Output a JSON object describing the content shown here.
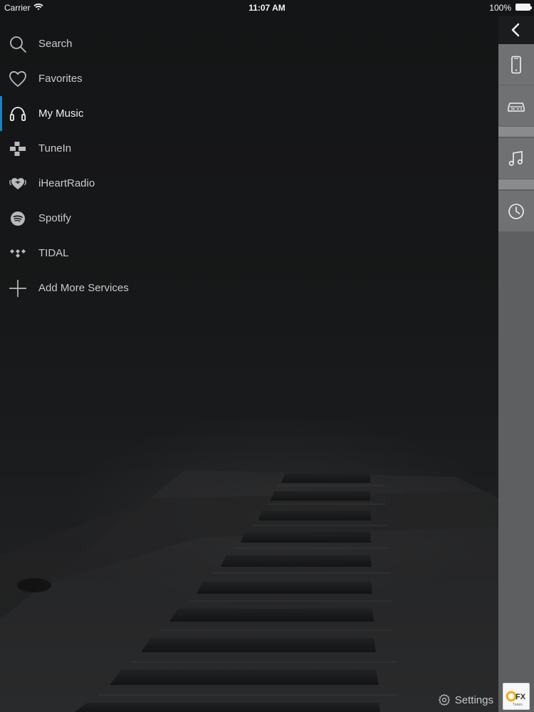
{
  "status_bar": {
    "carrier": "Carrier",
    "time": "11:07 AM",
    "battery": "100%"
  },
  "menu": {
    "items": [
      {
        "label": "Search",
        "icon": "search-icon",
        "active": false
      },
      {
        "label": "Favorites",
        "icon": "heart-icon",
        "active": false
      },
      {
        "label": "My Music",
        "icon": "headphones-icon",
        "active": true
      },
      {
        "label": "TuneIn",
        "icon": "tunein-icon",
        "active": false
      },
      {
        "label": "iHeartRadio",
        "icon": "iheartradio-icon",
        "active": false
      },
      {
        "label": "Spotify",
        "icon": "spotify-icon",
        "active": false
      },
      {
        "label": "TIDAL",
        "icon": "tidal-icon",
        "active": false
      },
      {
        "label": "Add More Services",
        "icon": "plus-icon",
        "active": false
      }
    ]
  },
  "right_rail": {
    "buttons": [
      {
        "name": "back",
        "icon": "chevron-left-icon"
      },
      {
        "name": "devices",
        "icon": "phone-icon"
      },
      {
        "name": "sources",
        "icon": "receiver-icon"
      },
      {
        "name": "music",
        "icon": "music-note-icon"
      },
      {
        "name": "history",
        "icon": "clock-icon"
      }
    ]
  },
  "footer": {
    "settings_label": "Settings",
    "logo_text": "QFX",
    "logo_subtext": "Tunes"
  },
  "colors": {
    "background": "#151617",
    "rail": "#5e5f61",
    "accent": "#1b83c5",
    "text": "#d7d8d9"
  }
}
